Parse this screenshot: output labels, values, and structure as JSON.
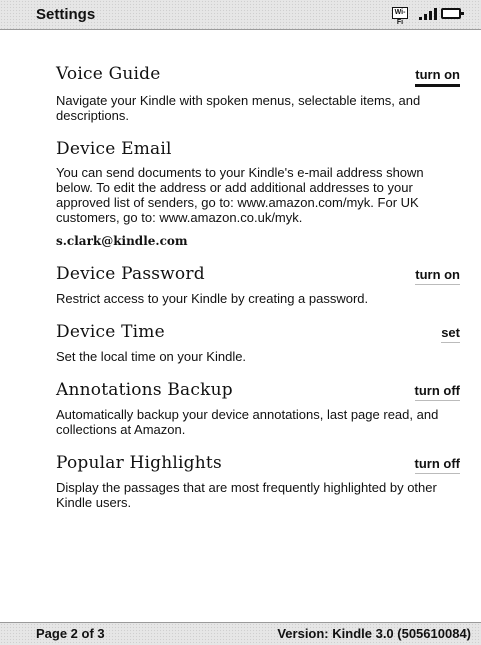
{
  "header": {
    "title": "Settings",
    "wifi_label": "Wi-Fi"
  },
  "sections": [
    {
      "title": "Voice Guide",
      "action": "turn on",
      "description": "Navigate your Kindle with spoken menus, selectable items, and descriptions."
    },
    {
      "title": "Device Email",
      "description": "You can send documents to your Kindle's e-mail address shown below. To edit the address or add additional addresses to your approved list of senders, go to: www.amazon.com/myk. For UK customers, go to: www.amazon.co.uk/myk.",
      "email": "s.clark@kindle.com"
    },
    {
      "title": "Device Password",
      "action": "turn on",
      "description": "Restrict access to your Kindle by creating a password."
    },
    {
      "title": "Device Time",
      "action": "set",
      "description": "Set the local time on your Kindle."
    },
    {
      "title": "Annotations Backup",
      "action": "turn off",
      "description": "Automatically backup your device annotations, last page read, and collections at Amazon."
    },
    {
      "title": "Popular Highlights",
      "action": "turn off",
      "description": "Display the passages that are most frequently highlighted by other Kindle users."
    }
  ],
  "footer": {
    "page": "Page 2 of 3",
    "version": "Version: Kindle 3.0 (505610084)"
  }
}
